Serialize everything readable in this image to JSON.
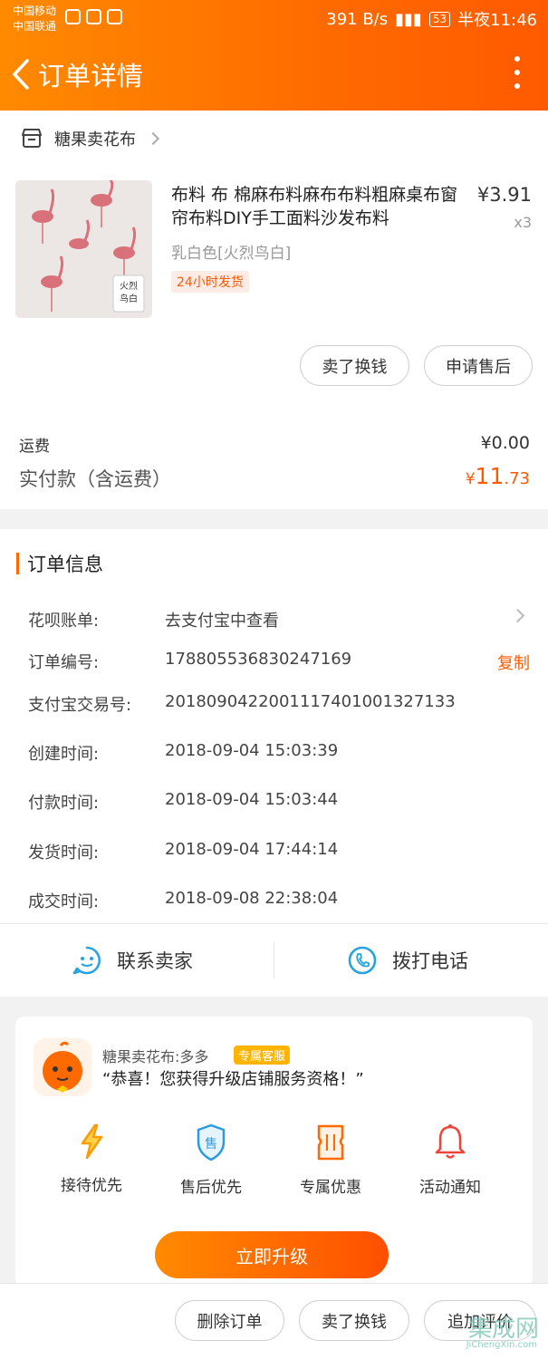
{
  "status_bar": {
    "carrier_1": "中国移动",
    "carrier_2": "中国联通",
    "net_speed": "391 B/s",
    "battery": "53",
    "time": "半夜11:46"
  },
  "header": {
    "title": "订单详情"
  },
  "shop": {
    "name": "糖果卖花布"
  },
  "product": {
    "image_text": "火烈\n鸟白",
    "title": "布料 布 棉麻布料麻布布料粗麻桌布窗帘布料DIY手工面料沙发布料",
    "price": "¥3.91",
    "qty": "x3",
    "sku": "乳白色[火烈鸟白]",
    "badge": "24小时发货"
  },
  "item_actions": {
    "sell": "卖了换钱",
    "after_sales": "申请售后"
  },
  "fees": {
    "shipping_label": "运费",
    "shipping_value": "¥0.00",
    "total_label": "实付款（含运费）",
    "total_currency": "¥",
    "total_int": "11",
    "total_dec": ".73"
  },
  "order_info": {
    "heading": "订单信息",
    "rows": [
      {
        "label": "花呗账单:",
        "value": "去支付宝中查看"
      },
      {
        "label": "订单编号:",
        "value": "178805536830247169"
      },
      {
        "label": "支付宝交易号:",
        "value": "2018090422001117401001327133"
      },
      {
        "label": "创建时间:",
        "value": "2018-09-04 15:03:39"
      },
      {
        "label": "付款时间:",
        "value": "2018-09-04 15:03:44"
      },
      {
        "label": "发货时间:",
        "value": "2018-09-04 17:44:14"
      },
      {
        "label": "成交时间:",
        "value": "2018-09-08 22:38:04"
      }
    ],
    "copy_label": "复制"
  },
  "contact": {
    "seller": "联系卖家",
    "phone": "拨打电话"
  },
  "promo": {
    "name": "糖果卖花布:多多",
    "tag": "专属客服",
    "message": "“恭喜！您获得升级店铺服务资格！”",
    "features": [
      {
        "label": "接待优先",
        "icon": "lightning-icon"
      },
      {
        "label": "售后优先",
        "icon": "shield-sale-icon"
      },
      {
        "label": "专属优惠",
        "icon": "ticket-icon"
      },
      {
        "label": "活动通知",
        "icon": "bell-icon"
      }
    ],
    "upgrade": "立即升级"
  },
  "bottom_actions": {
    "delete": "删除订单",
    "sell": "卖了换钱",
    "review": "追加评价"
  },
  "watermark": {
    "big": "集成网",
    "small": "JiChengXin.com"
  },
  "colors": {
    "accent": "#ff6a00",
    "brand_gradient_start": "#ff8a00"
  }
}
